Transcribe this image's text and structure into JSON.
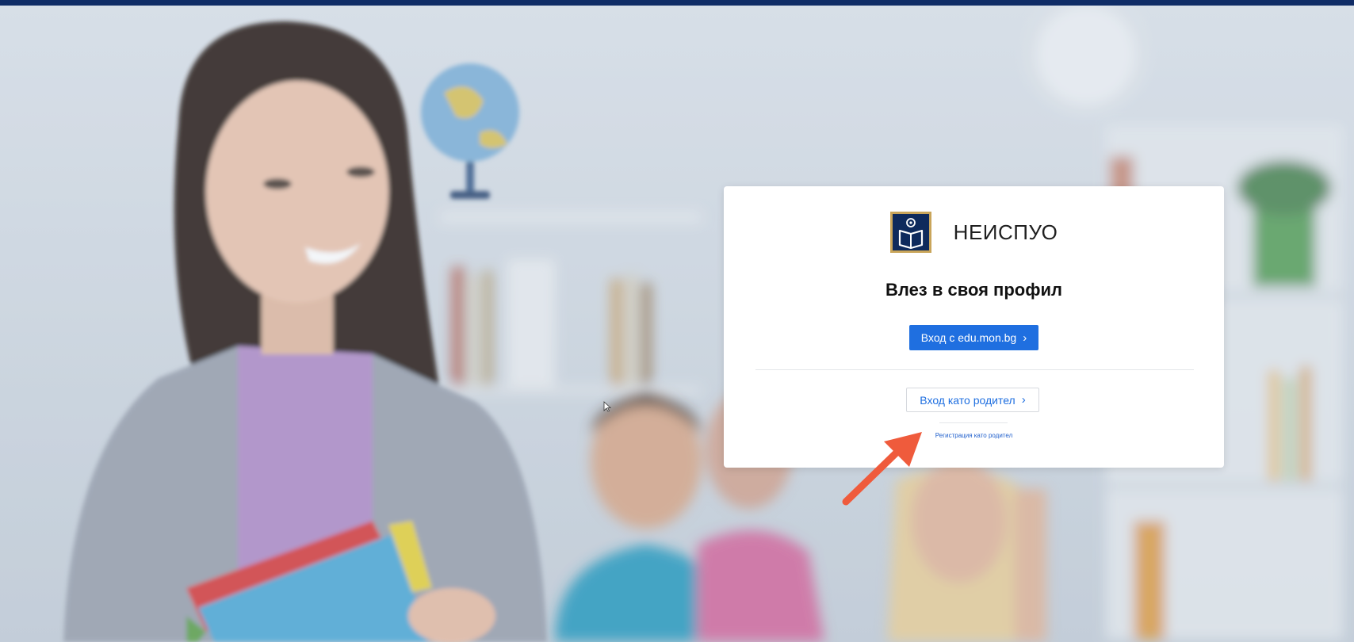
{
  "card": {
    "brand_name": "НЕИСПУО",
    "title": "Влез в своя профил",
    "primary_button_label": "Вход с edu.mon.bg",
    "secondary_button_label": "Вход като родител",
    "register_link": "Регистрация като родител"
  },
  "colors": {
    "top_strip": "#0f2c66",
    "primary": "#1f6fe0",
    "link": "#1f5fcc",
    "arrow": "#ef5b3c",
    "logo_navy": "#0e2a5c",
    "logo_gold": "#c9a55a"
  },
  "icons": {
    "logo": "book-logo-icon",
    "chevron": "chevron-right-icon",
    "annotation": "annotation-arrow-icon",
    "cursor": "mouse-pointer-icon"
  }
}
